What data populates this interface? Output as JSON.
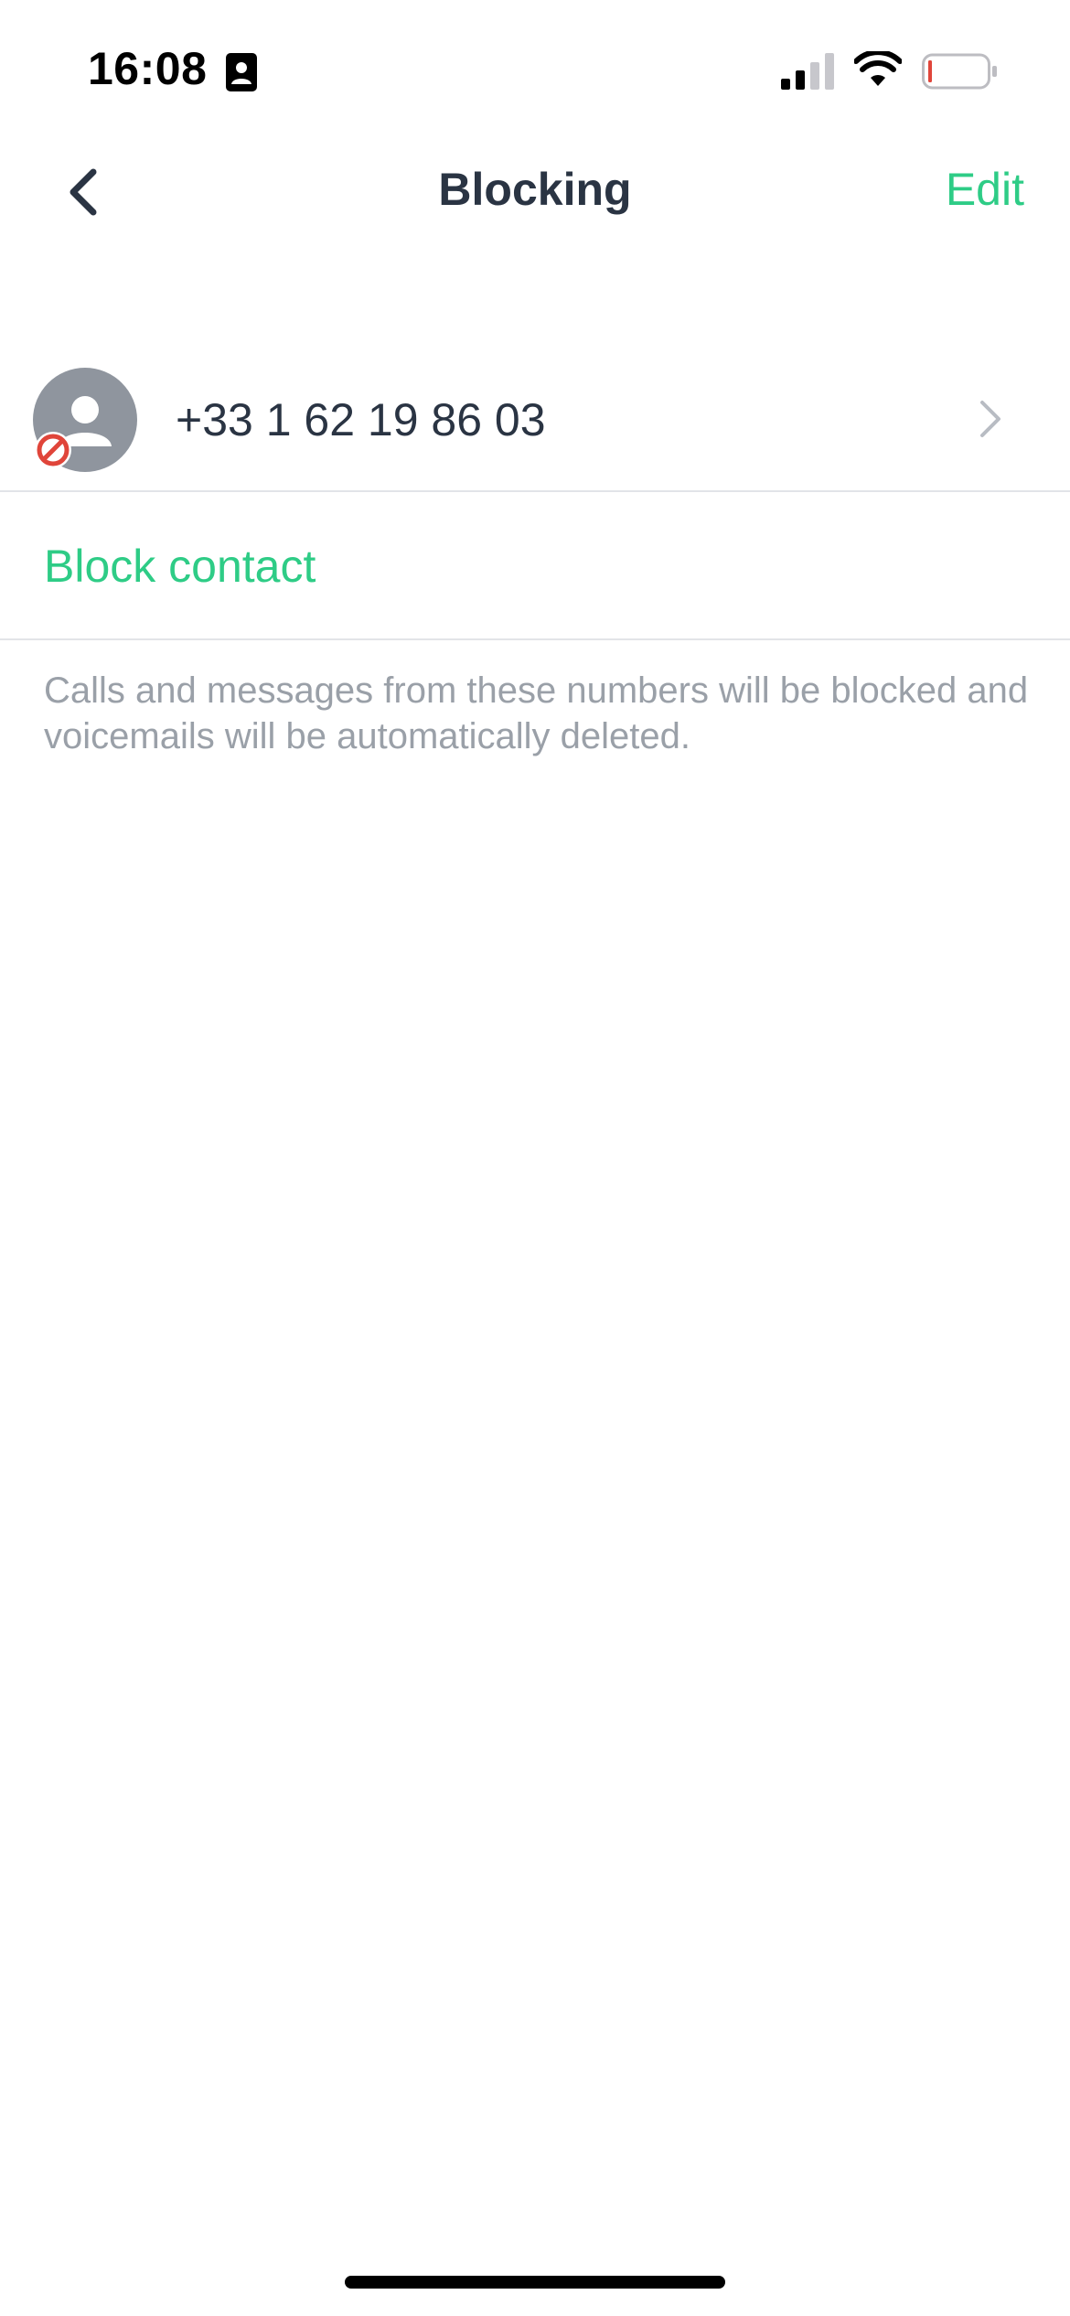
{
  "status_bar": {
    "time": "16:08",
    "icons": [
      "contact-card-icon",
      "signal-icon",
      "wifi-icon",
      "battery-icon"
    ]
  },
  "nav": {
    "back_icon": "chevron-left-icon",
    "title": "Blocking",
    "edit_label": "Edit"
  },
  "blocked_list": [
    {
      "phone": "+33 1 62 19 86 03",
      "avatar_icon": "person-icon",
      "badge_icon": "blocked-icon"
    }
  ],
  "actions": {
    "block_contact_label": "Block contact"
  },
  "footer": {
    "note": "Calls and messages from these numbers will be blocked and voicemails will be automatically deleted."
  },
  "colors": {
    "accent": "#2ecc86",
    "title_text": "#2a3443",
    "muted_text": "#9aa0a8",
    "avatar_bg": "#8f959e",
    "blocked_red": "#e0453a",
    "divider": "#e2e4e8"
  }
}
